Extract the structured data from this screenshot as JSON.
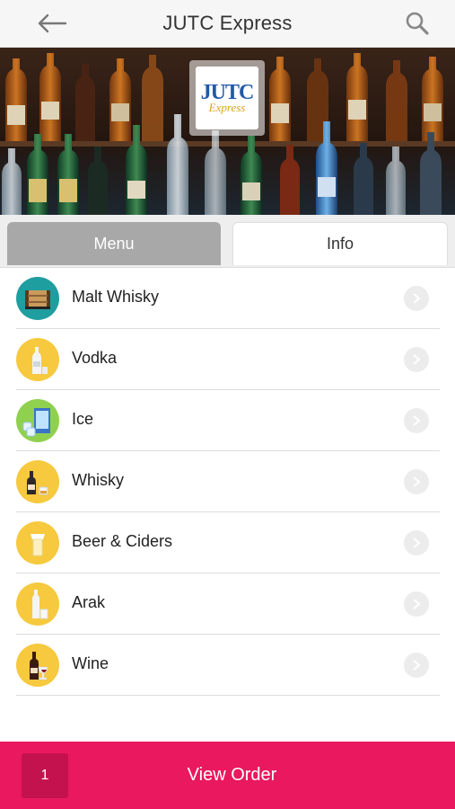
{
  "header": {
    "title": "JUTC Express",
    "back_icon": "arrow-left-icon",
    "search_icon": "search-icon"
  },
  "hero": {
    "logo_main": "JUTC",
    "logo_sub": "Express"
  },
  "tabs": [
    {
      "label": "Menu",
      "active": true
    },
    {
      "label": "Info",
      "active": false
    }
  ],
  "categories": [
    {
      "label": "Malt Whisky",
      "icon": "barrel-icon",
      "color": "#1f9ea0"
    },
    {
      "label": "Vodka",
      "icon": "vodka-bottle-icon",
      "color": "#f6c93e"
    },
    {
      "label": "Ice",
      "icon": "ice-cooler-icon",
      "color": "#8fd14f"
    },
    {
      "label": "Whisky",
      "icon": "whisky-bottle-icon",
      "color": "#f6c93e"
    },
    {
      "label": "Beer & Ciders",
      "icon": "beer-mug-icon",
      "color": "#f6c93e"
    },
    {
      "label": "Arak",
      "icon": "arak-bottle-icon",
      "color": "#f6c93e"
    },
    {
      "label": "Wine",
      "icon": "wine-bottle-icon",
      "color": "#f6c93e"
    }
  ],
  "footer": {
    "count": "1",
    "view_order_label": "View Order"
  },
  "colors": {
    "accent": "#e9185f",
    "tab_active": "#a8a8a8"
  }
}
